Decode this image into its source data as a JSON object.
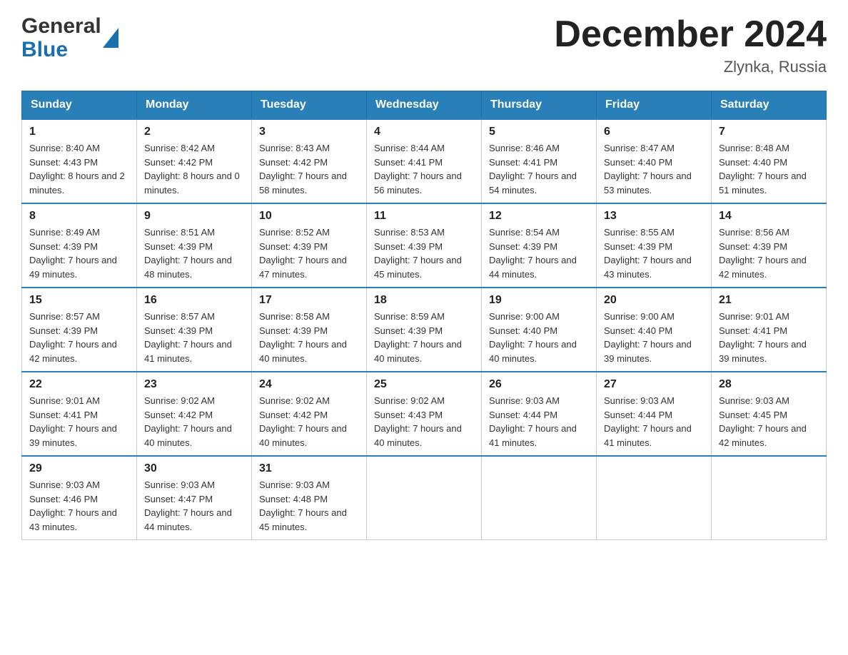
{
  "header": {
    "logo": {
      "line1": "General",
      "line2": "Blue"
    },
    "title": "December 2024",
    "location": "Zlynka, Russia"
  },
  "calendar": {
    "days_of_week": [
      "Sunday",
      "Monday",
      "Tuesday",
      "Wednesday",
      "Thursday",
      "Friday",
      "Saturday"
    ],
    "weeks": [
      [
        {
          "day": "1",
          "sunrise": "8:40 AM",
          "sunset": "4:43 PM",
          "daylight": "8 hours and 2 minutes."
        },
        {
          "day": "2",
          "sunrise": "8:42 AM",
          "sunset": "4:42 PM",
          "daylight": "8 hours and 0 minutes."
        },
        {
          "day": "3",
          "sunrise": "8:43 AM",
          "sunset": "4:42 PM",
          "daylight": "7 hours and 58 minutes."
        },
        {
          "day": "4",
          "sunrise": "8:44 AM",
          "sunset": "4:41 PM",
          "daylight": "7 hours and 56 minutes."
        },
        {
          "day": "5",
          "sunrise": "8:46 AM",
          "sunset": "4:41 PM",
          "daylight": "7 hours and 54 minutes."
        },
        {
          "day": "6",
          "sunrise": "8:47 AM",
          "sunset": "4:40 PM",
          "daylight": "7 hours and 53 minutes."
        },
        {
          "day": "7",
          "sunrise": "8:48 AM",
          "sunset": "4:40 PM",
          "daylight": "7 hours and 51 minutes."
        }
      ],
      [
        {
          "day": "8",
          "sunrise": "8:49 AM",
          "sunset": "4:39 PM",
          "daylight": "7 hours and 49 minutes."
        },
        {
          "day": "9",
          "sunrise": "8:51 AM",
          "sunset": "4:39 PM",
          "daylight": "7 hours and 48 minutes."
        },
        {
          "day": "10",
          "sunrise": "8:52 AM",
          "sunset": "4:39 PM",
          "daylight": "7 hours and 47 minutes."
        },
        {
          "day": "11",
          "sunrise": "8:53 AM",
          "sunset": "4:39 PM",
          "daylight": "7 hours and 45 minutes."
        },
        {
          "day": "12",
          "sunrise": "8:54 AM",
          "sunset": "4:39 PM",
          "daylight": "7 hours and 44 minutes."
        },
        {
          "day": "13",
          "sunrise": "8:55 AM",
          "sunset": "4:39 PM",
          "daylight": "7 hours and 43 minutes."
        },
        {
          "day": "14",
          "sunrise": "8:56 AM",
          "sunset": "4:39 PM",
          "daylight": "7 hours and 42 minutes."
        }
      ],
      [
        {
          "day": "15",
          "sunrise": "8:57 AM",
          "sunset": "4:39 PM",
          "daylight": "7 hours and 42 minutes."
        },
        {
          "day": "16",
          "sunrise": "8:57 AM",
          "sunset": "4:39 PM",
          "daylight": "7 hours and 41 minutes."
        },
        {
          "day": "17",
          "sunrise": "8:58 AM",
          "sunset": "4:39 PM",
          "daylight": "7 hours and 40 minutes."
        },
        {
          "day": "18",
          "sunrise": "8:59 AM",
          "sunset": "4:39 PM",
          "daylight": "7 hours and 40 minutes."
        },
        {
          "day": "19",
          "sunrise": "9:00 AM",
          "sunset": "4:40 PM",
          "daylight": "7 hours and 40 minutes."
        },
        {
          "day": "20",
          "sunrise": "9:00 AM",
          "sunset": "4:40 PM",
          "daylight": "7 hours and 39 minutes."
        },
        {
          "day": "21",
          "sunrise": "9:01 AM",
          "sunset": "4:41 PM",
          "daylight": "7 hours and 39 minutes."
        }
      ],
      [
        {
          "day": "22",
          "sunrise": "9:01 AM",
          "sunset": "4:41 PM",
          "daylight": "7 hours and 39 minutes."
        },
        {
          "day": "23",
          "sunrise": "9:02 AM",
          "sunset": "4:42 PM",
          "daylight": "7 hours and 40 minutes."
        },
        {
          "day": "24",
          "sunrise": "9:02 AM",
          "sunset": "4:42 PM",
          "daylight": "7 hours and 40 minutes."
        },
        {
          "day": "25",
          "sunrise": "9:02 AM",
          "sunset": "4:43 PM",
          "daylight": "7 hours and 40 minutes."
        },
        {
          "day": "26",
          "sunrise": "9:03 AM",
          "sunset": "4:44 PM",
          "daylight": "7 hours and 41 minutes."
        },
        {
          "day": "27",
          "sunrise": "9:03 AM",
          "sunset": "4:44 PM",
          "daylight": "7 hours and 41 minutes."
        },
        {
          "day": "28",
          "sunrise": "9:03 AM",
          "sunset": "4:45 PM",
          "daylight": "7 hours and 42 minutes."
        }
      ],
      [
        {
          "day": "29",
          "sunrise": "9:03 AM",
          "sunset": "4:46 PM",
          "daylight": "7 hours and 43 minutes."
        },
        {
          "day": "30",
          "sunrise": "9:03 AM",
          "sunset": "4:47 PM",
          "daylight": "7 hours and 44 minutes."
        },
        {
          "day": "31",
          "sunrise": "9:03 AM",
          "sunset": "4:48 PM",
          "daylight": "7 hours and 45 minutes."
        },
        null,
        null,
        null,
        null
      ]
    ]
  }
}
